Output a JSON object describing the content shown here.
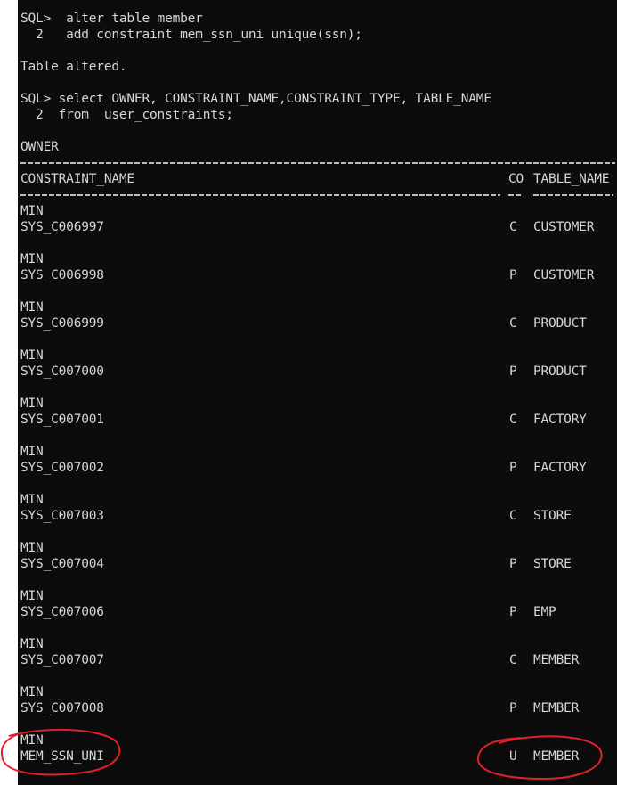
{
  "commands": {
    "alter1": "SQL>  alter table member",
    "alter2": "  2   add constraint mem_ssn_uni unique(ssn);",
    "altered": "Table altered.",
    "select1": "SQL> select OWNER, CONSTRAINT_NAME,CONSTRAINT_TYPE, TABLE_NAME",
    "select2": "  2  from  user_constraints;"
  },
  "headers": {
    "owner": "OWNER",
    "constraint_name": "CONSTRAINT_NAME",
    "constraint_type": "CO",
    "table_name": "TABLE_NAME"
  },
  "rows": [
    {
      "owner": "MIN",
      "name": "SYS_C006997",
      "type": "C",
      "table": "CUSTOMER"
    },
    {
      "owner": "MIN",
      "name": "SYS_C006998",
      "type": "P",
      "table": "CUSTOMER"
    },
    {
      "owner": "MIN",
      "name": "SYS_C006999",
      "type": "C",
      "table": "PRODUCT"
    },
    {
      "owner": "MIN",
      "name": "SYS_C007000",
      "type": "P",
      "table": "PRODUCT"
    },
    {
      "owner": "MIN",
      "name": "SYS_C007001",
      "type": "C",
      "table": "FACTORY"
    },
    {
      "owner": "MIN",
      "name": "SYS_C007002",
      "type": "P",
      "table": "FACTORY"
    },
    {
      "owner": "MIN",
      "name": "SYS_C007003",
      "type": "C",
      "table": "STORE"
    },
    {
      "owner": "MIN",
      "name": "SYS_C007004",
      "type": "P",
      "table": "STORE"
    },
    {
      "owner": "MIN",
      "name": "SYS_C007006",
      "type": "P",
      "table": "EMP"
    },
    {
      "owner": "MIN",
      "name": "SYS_C007007",
      "type": "C",
      "table": "MEMBER"
    },
    {
      "owner": "MIN",
      "name": "SYS_C007008",
      "type": "P",
      "table": "MEMBER"
    },
    {
      "owner": "MIN",
      "name": "MEM_SSN_UNI",
      "type": "U",
      "table": "MEMBER"
    }
  ],
  "colors": {
    "background": "#0c0c0c",
    "text": "#d6d6d6",
    "annotation": "#e0202a"
  }
}
